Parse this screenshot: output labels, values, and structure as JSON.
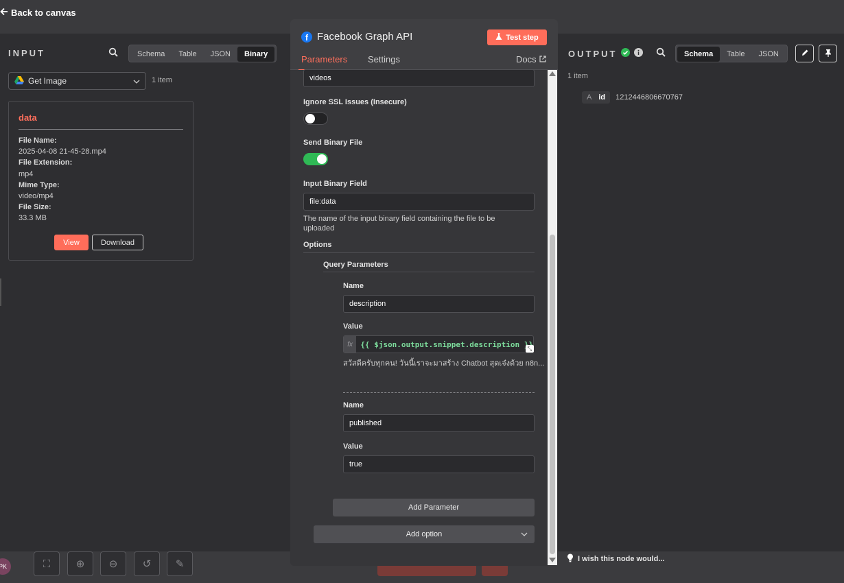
{
  "canvas": {
    "back_label": "Back to canvas",
    "avatar_initials": "PK"
  },
  "input": {
    "title": "INPUT",
    "views": [
      "Schema",
      "Table",
      "JSON",
      "Binary"
    ],
    "active_view": "Binary",
    "source_node": "Get Image",
    "item_count": "1 item",
    "card": {
      "title": "data",
      "fields": [
        {
          "key": "File Name:",
          "value": "2025-04-08 21-45-28.mp4"
        },
        {
          "key": "File Extension:",
          "value": "mp4"
        },
        {
          "key": "Mime Type:",
          "value": "video/mp4"
        },
        {
          "key": "File Size:",
          "value": "33.3 MB"
        }
      ],
      "view_label": "View",
      "download_label": "Download"
    }
  },
  "node": {
    "title": "Facebook Graph API",
    "test_label": "Test step",
    "tabs": [
      "Parameters",
      "Settings"
    ],
    "active_tab": "Parameters",
    "docs_label": "Docs",
    "edge_value": "videos",
    "ignore_ssl": {
      "label": "Ignore SSL Issues (Insecure)",
      "enabled": false
    },
    "send_binary": {
      "label": "Send Binary File",
      "enabled": true
    },
    "binary_field": {
      "label": "Input Binary Field",
      "value": "file:data",
      "hint": "The name of the input binary field containing the file to be uploaded"
    },
    "options_label": "Options",
    "query_params_label": "Query Parameters",
    "params": [
      {
        "name_label": "Name",
        "name": "description",
        "value_label": "Value",
        "value_expr": "{{ $json.output.snippet.description }}",
        "preview": "สวัสดีครับทุกคน! วันนี้เราจะมาสร้าง Chatbot สุดเจ๋งด้วย n8n..."
      },
      {
        "name_label": "Name",
        "name": "published",
        "value_label": "Value",
        "value": "true"
      }
    ],
    "fx_label": "fx",
    "add_parameter_label": "Add Parameter",
    "add_option_label": "Add option"
  },
  "output": {
    "title": "OUTPUT",
    "views": [
      "Schema",
      "Table",
      "JSON"
    ],
    "active_view": "Schema",
    "item_count": "1 item",
    "fields": [
      {
        "type_glyph": "A",
        "name": "id",
        "value": "1212446806670767"
      }
    ],
    "feedback_label": "I wish this node would..."
  },
  "colors": {
    "accent": "#ff6d5a",
    "success": "#2fb955",
    "facebook": "#1877f2",
    "toggle_on": "#2fb955"
  }
}
